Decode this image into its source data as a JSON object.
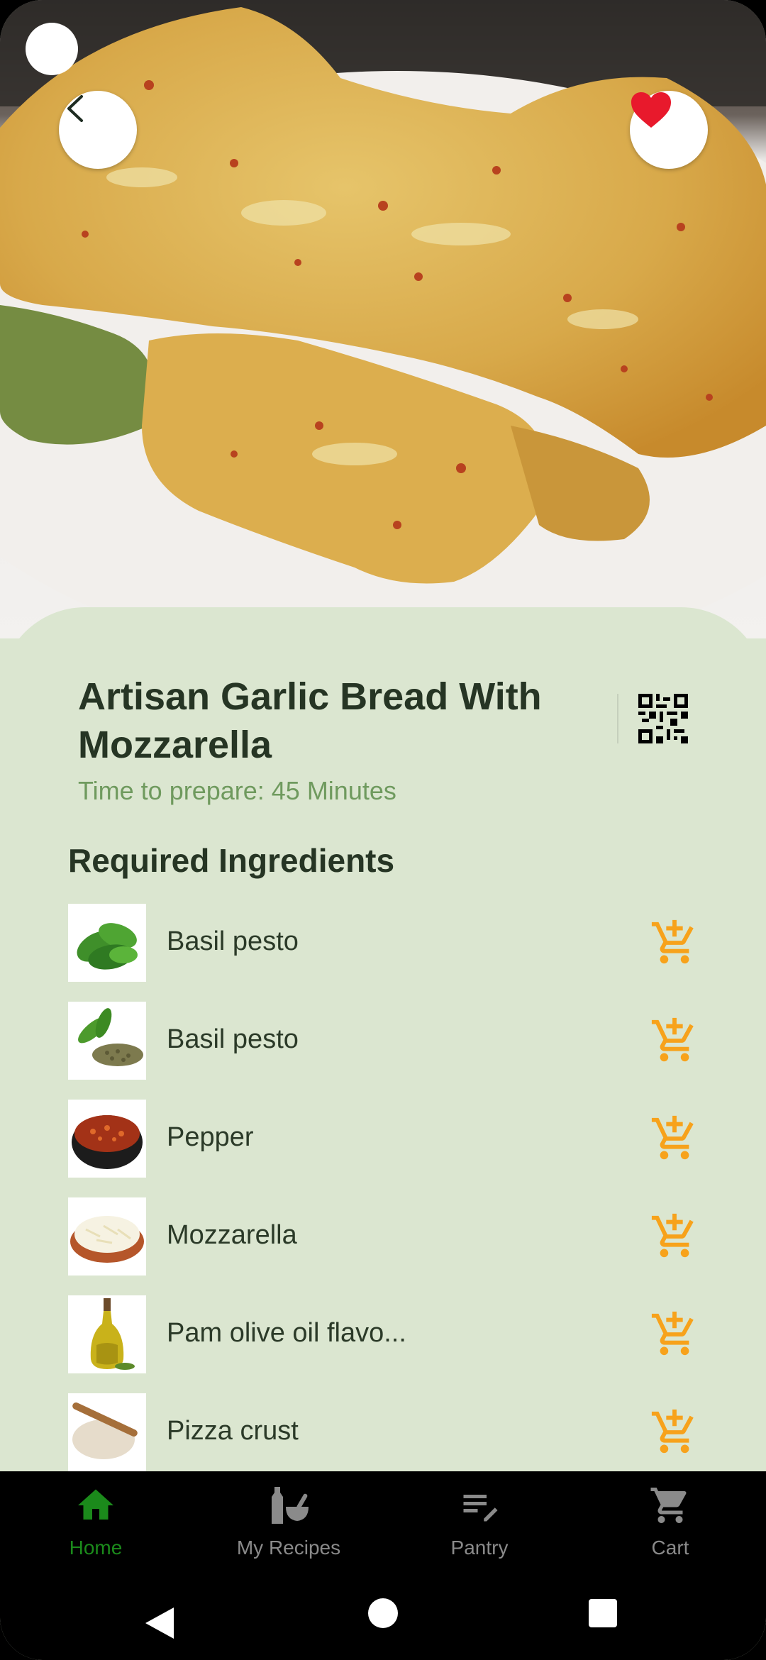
{
  "recipe": {
    "title": "Artisan Garlic Bread With Mozzarella",
    "prep_time": "Time to prepare: 45 Minutes"
  },
  "ingredients_section": {
    "heading": "Required Ingredients",
    "items": [
      {
        "name": "Basil pesto",
        "thumb": "basil-leaves"
      },
      {
        "name": "Basil pesto",
        "thumb": "basil-dried-herbs"
      },
      {
        "name": "Pepper",
        "thumb": "chili-flakes-bowl"
      },
      {
        "name": "Mozzarella",
        "thumb": "shredded-cheese"
      },
      {
        "name": "Pam olive oil flavo...",
        "thumb": "olive-oil-bottle"
      },
      {
        "name": "Pizza crust",
        "thumb": "dough-rolling-pin"
      }
    ]
  },
  "nav": {
    "items": [
      {
        "label": "Home",
        "icon": "home-icon",
        "active": true
      },
      {
        "label": "My Recipes",
        "icon": "recipes-icon",
        "active": false
      },
      {
        "label": "Pantry",
        "icon": "pantry-icon",
        "active": false
      },
      {
        "label": "Cart",
        "icon": "cart-icon",
        "active": false
      }
    ]
  },
  "colors": {
    "sheet_bg": "#dbe6d0",
    "accent_orange": "#f7a21b",
    "nav_active": "#1b8a1b",
    "favorite_red": "#e8192c"
  }
}
